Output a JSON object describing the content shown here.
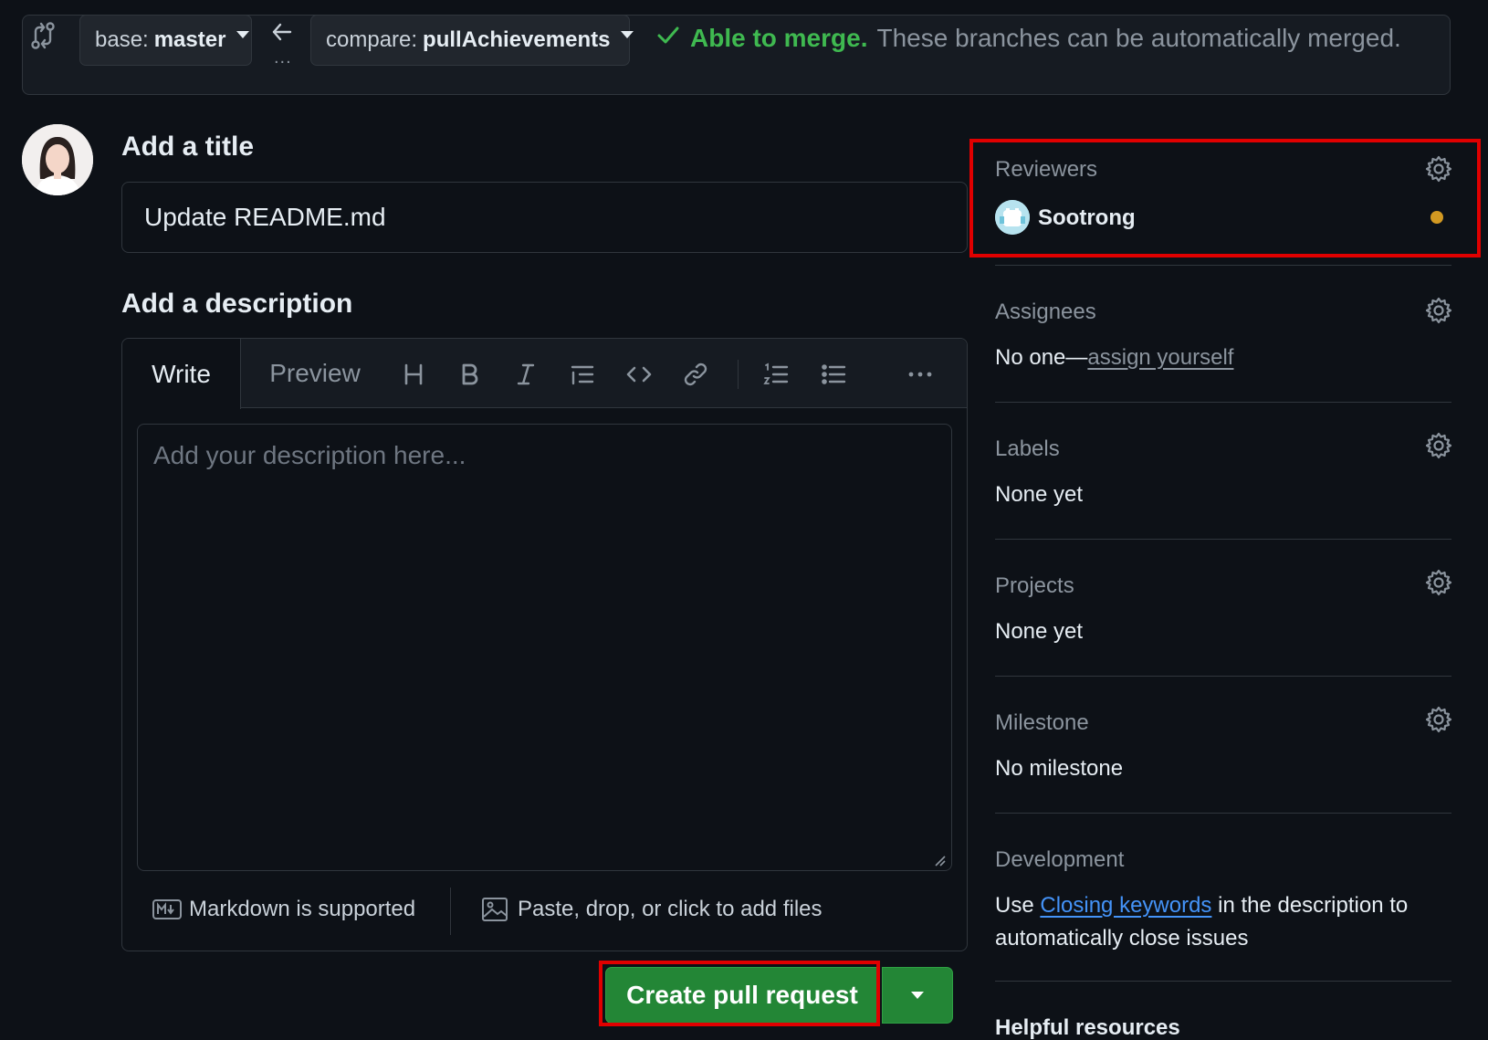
{
  "compare_bar": {
    "base_prefix": "base:",
    "base_branch": "master",
    "compare_prefix": "compare:",
    "compare_branch": "pullAchievements",
    "arrow_dots": "...",
    "merge_ok": "Able to merge.",
    "merge_message": "These branches can be automatically merged."
  },
  "form": {
    "title_heading": "Add a title",
    "title_value": "Update README.md",
    "description_heading": "Add a description",
    "tabs": {
      "write": "Write",
      "preview": "Preview"
    },
    "toolbar_icons": [
      "heading-icon",
      "bold-icon",
      "italic-icon",
      "quote-icon",
      "code-icon",
      "link-icon",
      "ordered-list-icon",
      "unordered-list-icon",
      "more-icon"
    ],
    "description_placeholder": "Add your description here...",
    "markdown_note": "Markdown is supported",
    "attach_note": "Paste, drop, or click to add files",
    "create_button": "Create pull request"
  },
  "sidebar": {
    "reviewers": {
      "label": "Reviewers",
      "name": "Sootrong"
    },
    "assignees": {
      "label": "Assignees",
      "prefix": "No one—",
      "link": "assign yourself"
    },
    "labels": {
      "label": "Labels",
      "value": "None yet"
    },
    "projects": {
      "label": "Projects",
      "value": "None yet"
    },
    "milestone": {
      "label": "Milestone",
      "value": "No milestone"
    },
    "development": {
      "label": "Development",
      "text_before": "Use ",
      "link": "Closing keywords",
      "text_after": " in the description to automatically close issues"
    },
    "helpful_resources": "Helpful resources"
  },
  "colors": {
    "background": "#0d1117",
    "success": "#3fb950",
    "primary_button": "#238636",
    "link": "#4493f8",
    "highlight": "#e00000",
    "pending": "#d29922"
  }
}
